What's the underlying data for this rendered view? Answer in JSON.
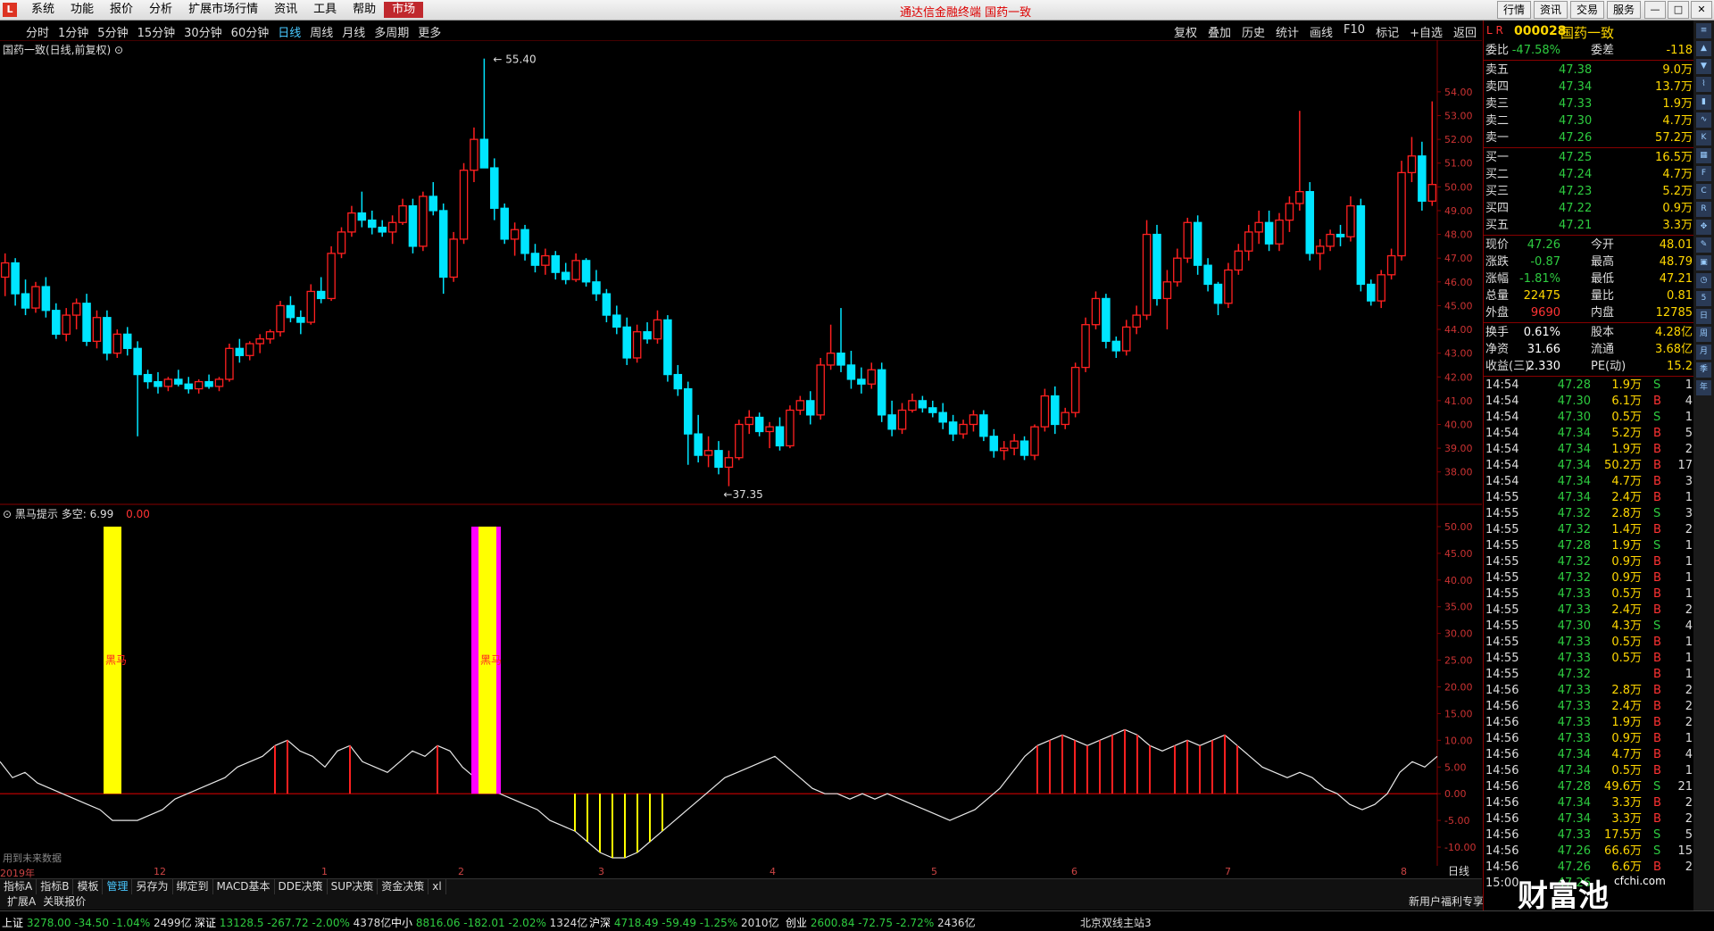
{
  "menu": [
    "系统",
    "功能",
    "报价",
    "分析",
    "扩展市场行情",
    "资讯",
    "工具",
    "帮助",
    "市场"
  ],
  "title_center": "通达信金融终端  国药一致",
  "title_right": [
    "行情",
    "资讯",
    "交易",
    "服务"
  ],
  "periods": [
    "分时",
    "1分钟",
    "5分钟",
    "15分钟",
    "30分钟",
    "60分钟",
    "日线",
    "周线",
    "月线",
    "多周期",
    "更多"
  ],
  "active_period": "日线",
  "tools": [
    "复权",
    "叠加",
    "历史",
    "统计",
    "画线",
    "F10",
    "标记",
    "+自选",
    "返回"
  ],
  "chart_title": "国药一致(日线,前复权)",
  "indicator": {
    "name": "黑马提示",
    "param": "多空: 6.99",
    "value": "0.00",
    "mark": "黑马",
    "future_note": "用到未来数据"
  },
  "colors": {
    "up": "#ff2020",
    "down": "#00e5ff",
    "yellow": "#ffff00",
    "magenta": "#ff00ff",
    "green": "#2ecc40"
  },
  "chart_data": {
    "type": "candlestick",
    "high_label": "55.40",
    "low_label": "37.35",
    "yaxis_main": [
      "54.00",
      "53.00",
      "52.00",
      "51.00",
      "50.00",
      "49.00",
      "48.00",
      "47.00",
      "46.00",
      "45.00",
      "44.00",
      "43.00",
      "42.00",
      "41.00",
      "40.00",
      "39.00",
      "38.00"
    ],
    "yaxis_ind": [
      "50.00",
      "45.00",
      "40.00",
      "35.00",
      "30.00",
      "25.00",
      "20.00",
      "15.00",
      "10.00",
      "5.00",
      "0.00",
      "-5.00",
      "-10.00"
    ],
    "ylim_main": [
      37.2,
      55.8
    ],
    "ylim_ind": [
      -12,
      52
    ],
    "candles": [
      [
        46.2,
        47.2,
        45.4,
        46.8
      ],
      [
        46.8,
        47.0,
        45.0,
        45.5
      ],
      [
        45.5,
        46.1,
        44.6,
        44.9
      ],
      [
        44.9,
        46.0,
        44.7,
        45.8
      ],
      [
        45.8,
        46.2,
        44.5,
        44.8
      ],
      [
        44.8,
        45.1,
        43.6,
        43.8
      ],
      [
        43.8,
        44.9,
        43.5,
        44.6
      ],
      [
        44.6,
        45.3,
        44.0,
        45.1
      ],
      [
        45.1,
        45.5,
        43.3,
        43.5
      ],
      [
        43.5,
        44.8,
        43.2,
        44.5
      ],
      [
        44.5,
        44.8,
        42.7,
        43.0
      ],
      [
        43.0,
        44.0,
        42.8,
        43.8
      ],
      [
        43.8,
        44.1,
        42.9,
        43.2
      ],
      [
        43.2,
        43.5,
        39.5,
        42.1
      ],
      [
        42.1,
        42.3,
        41.5,
        41.8
      ],
      [
        41.8,
        42.2,
        41.3,
        41.6
      ],
      [
        41.6,
        42.0,
        41.4,
        41.9
      ],
      [
        41.9,
        42.3,
        41.6,
        41.7
      ],
      [
        41.7,
        42.0,
        41.3,
        41.5
      ],
      [
        41.5,
        41.9,
        41.3,
        41.8
      ],
      [
        41.8,
        42.1,
        41.5,
        41.6
      ],
      [
        41.6,
        42.0,
        41.4,
        41.9
      ],
      [
        41.9,
        43.4,
        41.8,
        43.2
      ],
      [
        43.2,
        43.6,
        42.6,
        42.9
      ],
      [
        42.9,
        43.5,
        42.7,
        43.4
      ],
      [
        43.4,
        43.8,
        43.0,
        43.6
      ],
      [
        43.6,
        44.0,
        43.4,
        43.9
      ],
      [
        43.9,
        45.2,
        43.7,
        45.0
      ],
      [
        45.0,
        45.4,
        44.3,
        44.5
      ],
      [
        44.5,
        44.8,
        43.8,
        44.3
      ],
      [
        44.3,
        45.9,
        44.2,
        45.6
      ],
      [
        45.6,
        46.2,
        45.1,
        45.3
      ],
      [
        45.3,
        47.5,
        45.2,
        47.2
      ],
      [
        47.2,
        48.3,
        47.0,
        48.1
      ],
      [
        48.1,
        49.2,
        47.9,
        48.9
      ],
      [
        48.9,
        49.8,
        48.3,
        48.6
      ],
      [
        48.6,
        49.0,
        48.0,
        48.3
      ],
      [
        48.3,
        48.6,
        47.9,
        48.1
      ],
      [
        48.1,
        48.8,
        47.6,
        48.5
      ],
      [
        48.5,
        49.5,
        48.4,
        49.2
      ],
      [
        49.2,
        49.5,
        47.2,
        47.5
      ],
      [
        47.5,
        49.8,
        47.3,
        49.6
      ],
      [
        49.6,
        50.2,
        48.8,
        49.0
      ],
      [
        49.0,
        49.3,
        45.5,
        46.2
      ],
      [
        46.2,
        48.1,
        46.0,
        47.8
      ],
      [
        47.8,
        51.0,
        47.6,
        50.7
      ],
      [
        50.7,
        52.5,
        50.2,
        52.0
      ],
      [
        52.0,
        55.4,
        51.8,
        50.8
      ],
      [
        50.8,
        51.2,
        48.6,
        49.1
      ],
      [
        49.1,
        49.3,
        47.6,
        47.8
      ],
      [
        47.8,
        48.5,
        47.1,
        48.2
      ],
      [
        48.2,
        48.4,
        46.9,
        47.2
      ],
      [
        47.2,
        47.6,
        46.4,
        46.7
      ],
      [
        46.7,
        47.4,
        46.3,
        47.1
      ],
      [
        47.1,
        47.3,
        46.1,
        46.4
      ],
      [
        46.4,
        46.8,
        45.9,
        46.1
      ],
      [
        46.1,
        47.2,
        46.0,
        46.9
      ],
      [
        46.9,
        47.0,
        45.8,
        46.0
      ],
      [
        46.0,
        46.5,
        45.2,
        45.5
      ],
      [
        45.5,
        45.7,
        44.3,
        44.6
      ],
      [
        44.6,
        45.0,
        43.8,
        44.1
      ],
      [
        44.1,
        44.5,
        42.5,
        42.8
      ],
      [
        42.8,
        44.2,
        42.6,
        43.9
      ],
      [
        43.9,
        44.3,
        43.4,
        43.6
      ],
      [
        43.6,
        44.8,
        43.4,
        44.4
      ],
      [
        44.4,
        44.6,
        41.8,
        42.1
      ],
      [
        42.1,
        42.5,
        41.2,
        41.5
      ],
      [
        41.5,
        41.8,
        38.3,
        39.6
      ],
      [
        39.6,
        40.4,
        38.4,
        38.7
      ],
      [
        38.7,
        39.5,
        38.2,
        38.9
      ],
      [
        38.9,
        39.3,
        37.9,
        38.2
      ],
      [
        38.2,
        38.9,
        37.4,
        38.6
      ],
      [
        38.6,
        40.2,
        38.5,
        40.0
      ],
      [
        40.0,
        40.6,
        39.6,
        40.3
      ],
      [
        40.3,
        40.5,
        39.5,
        39.7
      ],
      [
        39.7,
        40.1,
        39.0,
        39.9
      ],
      [
        39.9,
        40.3,
        38.9,
        39.1
      ],
      [
        39.1,
        40.8,
        39.0,
        40.6
      ],
      [
        40.6,
        41.2,
        40.4,
        41.0
      ],
      [
        41.0,
        41.4,
        40.0,
        40.4
      ],
      [
        40.4,
        42.8,
        40.2,
        42.5
      ],
      [
        42.5,
        44.2,
        42.3,
        43.0
      ],
      [
        43.0,
        44.9,
        42.2,
        42.5
      ],
      [
        42.5,
        43.1,
        41.5,
        41.9
      ],
      [
        41.9,
        42.4,
        41.3,
        41.7
      ],
      [
        41.7,
        42.6,
        41.5,
        42.3
      ],
      [
        42.3,
        42.6,
        40.1,
        40.4
      ],
      [
        40.4,
        41.0,
        39.5,
        39.8
      ],
      [
        39.8,
        40.9,
        39.6,
        40.6
      ],
      [
        40.6,
        41.3,
        40.5,
        41.0
      ],
      [
        41.0,
        41.2,
        40.5,
        40.7
      ],
      [
        40.7,
        41.0,
        40.3,
        40.5
      ],
      [
        40.5,
        40.9,
        39.8,
        40.1
      ],
      [
        40.1,
        40.4,
        39.3,
        39.6
      ],
      [
        39.6,
        40.2,
        39.4,
        40.0
      ],
      [
        40.0,
        40.6,
        39.7,
        40.4
      ],
      [
        40.4,
        40.6,
        39.3,
        39.5
      ],
      [
        39.5,
        39.8,
        38.6,
        38.9
      ],
      [
        38.9,
        39.3,
        38.5,
        39.0
      ],
      [
        39.0,
        39.6,
        38.7,
        39.3
      ],
      [
        39.3,
        39.5,
        38.5,
        38.7
      ],
      [
        38.7,
        40.0,
        38.5,
        39.9
      ],
      [
        39.9,
        41.5,
        39.7,
        41.2
      ],
      [
        41.2,
        41.6,
        39.6,
        40.0
      ],
      [
        40.0,
        40.7,
        39.8,
        40.5
      ],
      [
        40.5,
        42.6,
        40.3,
        42.4
      ],
      [
        42.4,
        44.5,
        42.2,
        44.2
      ],
      [
        44.2,
        45.6,
        44.0,
        45.3
      ],
      [
        45.3,
        45.5,
        43.2,
        43.5
      ],
      [
        43.5,
        43.7,
        42.8,
        43.1
      ],
      [
        43.1,
        44.4,
        42.9,
        44.1
      ],
      [
        44.1,
        45.0,
        43.8,
        44.6
      ],
      [
        44.6,
        48.6,
        44.4,
        48.0
      ],
      [
        48.0,
        48.4,
        45.0,
        45.3
      ],
      [
        45.3,
        46.5,
        44.0,
        46.0
      ],
      [
        46.0,
        47.4,
        45.8,
        47.0
      ],
      [
        47.0,
        48.7,
        46.8,
        48.5
      ],
      [
        48.5,
        48.8,
        46.3,
        46.7
      ],
      [
        46.7,
        47.0,
        45.6,
        45.9
      ],
      [
        45.9,
        46.0,
        44.6,
        45.1
      ],
      [
        45.1,
        46.8,
        44.9,
        46.5
      ],
      [
        46.5,
        47.6,
        46.3,
        47.3
      ],
      [
        47.3,
        48.4,
        46.9,
        48.1
      ],
      [
        48.1,
        49.0,
        47.6,
        48.5
      ],
      [
        48.5,
        49.0,
        47.3,
        47.6
      ],
      [
        47.6,
        48.9,
        47.3,
        48.6
      ],
      [
        48.6,
        49.6,
        48.1,
        49.3
      ],
      [
        49.3,
        53.2,
        49.0,
        49.8
      ],
      [
        49.8,
        50.2,
        46.9,
        47.2
      ],
      [
        47.2,
        47.8,
        46.5,
        47.5
      ],
      [
        47.5,
        48.2,
        47.3,
        48.0
      ],
      [
        48.0,
        48.4,
        47.5,
        47.9
      ],
      [
        47.9,
        49.6,
        47.7,
        49.2
      ],
      [
        49.2,
        49.5,
        45.6,
        45.9
      ],
      [
        45.9,
        46.1,
        45.0,
        45.2
      ],
      [
        45.2,
        46.5,
        44.9,
        46.3
      ],
      [
        46.3,
        47.4,
        46.1,
        47.1
      ],
      [
        47.1,
        51.1,
        46.9,
        50.6
      ],
      [
        50.6,
        52.1,
        50.2,
        51.3
      ],
      [
        51.3,
        51.9,
        49.0,
        49.4
      ],
      [
        49.4,
        53.6,
        49.2,
        50.1
      ]
    ],
    "osc": [
      6,
      3,
      4,
      2,
      1,
      0,
      -1,
      -2,
      -3,
      -5,
      -5,
      -5,
      -4,
      -3,
      -1,
      0,
      1,
      2,
      3,
      5,
      6,
      7,
      9,
      10,
      8,
      7,
      5,
      8,
      9,
      6,
      5,
      4,
      6,
      8,
      7,
      9,
      8,
      5,
      3,
      1,
      0,
      -1,
      -2,
      -3,
      -5,
      -6,
      -7,
      -9,
      -11,
      -12,
      -12,
      -11,
      -9,
      -7,
      -5,
      -3,
      -1,
      1,
      3,
      4,
      5,
      6,
      7,
      5,
      3,
      1,
      0,
      0,
      -1,
      0,
      -1,
      0,
      -1,
      -2,
      -3,
      -4,
      -5,
      -4,
      -3,
      -1,
      1,
      4,
      7,
      9,
      10,
      11,
      10,
      9,
      10,
      11,
      12,
      11,
      9,
      8,
      9,
      10,
      9,
      10,
      11,
      9,
      7,
      5,
      4,
      3,
      4,
      3,
      1,
      0,
      -2,
      -3,
      -2,
      0,
      4,
      6,
      5,
      7
    ],
    "yellow_bars": [
      {
        "idx": 9,
        "w": 2
      },
      {
        "idx": 39,
        "w": 2
      }
    ],
    "magenta_bars": [
      {
        "idx": 39,
        "w": 3
      }
    ]
  },
  "dates": [
    "2019年",
    "12",
    "1",
    "2",
    "3",
    "4",
    "5",
    "6",
    "7",
    "8"
  ],
  "period_label": "日线",
  "ind_tabs": [
    "指标A",
    "指标B",
    "模板",
    "管理",
    "另存为",
    "绑定到",
    "MACD基本",
    "DDE决策",
    "SUP决策",
    "资金决策",
    "xl"
  ],
  "ind_tabs_active": "管理",
  "sub_left": [
    "扩展A",
    "关联报价"
  ],
  "sub_right": "新用户福利专享",
  "status": [
    {
      "name": "上证",
      "val": "3278.00",
      "chg": "-34.50",
      "pct": "-1.04%",
      "amt": "2499亿"
    },
    {
      "name": "深证",
      "val": "13128.5",
      "chg": "-267.72",
      "pct": "-2.00%",
      "amt": "4378亿"
    },
    {
      "name": "中小",
      "val": "8816.06",
      "chg": "-182.01",
      "pct": "-2.02%",
      "amt": "1324亿"
    },
    {
      "name": "沪深",
      "val": "4718.49",
      "chg": "-59.49",
      "pct": "-1.25%",
      "amt": "2010亿"
    },
    {
      "name": "创业",
      "val": "2600.84",
      "chg": "-72.75",
      "pct": "-2.72%",
      "amt": "2436亿"
    }
  ],
  "status_station": "北京双线主站3",
  "quote": {
    "code": "000028",
    "name": "国药一致",
    "weibi": {
      "label": "委比",
      "val": "-47.58%",
      "label2": "委差",
      "val2": "-118"
    },
    "sell": [
      {
        "l": "卖五",
        "p": "47.38",
        "v": "9.0万"
      },
      {
        "l": "卖四",
        "p": "47.34",
        "v": "13.7万"
      },
      {
        "l": "卖三",
        "p": "47.33",
        "v": "1.9万"
      },
      {
        "l": "卖二",
        "p": "47.30",
        "v": "4.7万"
      },
      {
        "l": "卖一",
        "p": "47.26",
        "v": "57.2万"
      }
    ],
    "buy": [
      {
        "l": "买一",
        "p": "47.25",
        "v": "16.5万"
      },
      {
        "l": "买二",
        "p": "47.24",
        "v": "4.7万"
      },
      {
        "l": "买三",
        "p": "47.23",
        "v": "5.2万"
      },
      {
        "l": "买四",
        "p": "47.22",
        "v": "0.9万"
      },
      {
        "l": "买五",
        "p": "47.21",
        "v": "3.3万"
      }
    ],
    "stats": [
      {
        "l": "现价",
        "v": "47.26",
        "l2": "今开",
        "v2": "48.01",
        "c1": "g",
        "c2": "r"
      },
      {
        "l": "涨跌",
        "v": "-0.87",
        "l2": "最高",
        "v2": "48.79",
        "c1": "g",
        "c2": "r"
      },
      {
        "l": "涨幅",
        "v": "-1.81%",
        "l2": "最低",
        "v2": "47.21",
        "c1": "g",
        "c2": "g"
      },
      {
        "l": "总量",
        "v": "22475",
        "l2": "量比",
        "v2": "0.81",
        "c1": "y",
        "c2": "y"
      },
      {
        "l": "外盘",
        "v": "9690",
        "l2": "内盘",
        "v2": "12785",
        "c1": "r",
        "c2": "g"
      }
    ],
    "stats2": [
      {
        "l": "换手",
        "v": "0.61%",
        "l2": "股本",
        "v2": "4.28亿"
      },
      {
        "l": "净资",
        "v": "31.66",
        "l2": "流通",
        "v2": "3.68亿"
      },
      {
        "l": "收益(三)",
        "v": "2.330",
        "l2": "PE(动)",
        "v2": "15.2"
      }
    ],
    "ticks": [
      [
        "14:54",
        "47.28",
        "1.9万",
        "S",
        "1"
      ],
      [
        "14:54",
        "47.30",
        "6.1万",
        "B",
        "4"
      ],
      [
        "14:54",
        "47.30",
        "0.5万",
        "S",
        "1"
      ],
      [
        "14:54",
        "47.34",
        "5.2万",
        "B",
        "5"
      ],
      [
        "14:54",
        "47.34",
        "1.9万",
        "B",
        "2"
      ],
      [
        "14:54",
        "47.34",
        "50.2万",
        "B",
        "17"
      ],
      [
        "14:54",
        "47.34",
        "4.7万",
        "B",
        "3"
      ],
      [
        "14:55",
        "47.34",
        "2.4万",
        "B",
        "1"
      ],
      [
        "14:55",
        "47.32",
        "2.8万",
        "S",
        "3"
      ],
      [
        "14:55",
        "47.32",
        "1.4万",
        "B",
        "2"
      ],
      [
        "14:55",
        "47.28",
        "1.9万",
        "S",
        "1"
      ],
      [
        "14:55",
        "47.32",
        "0.9万",
        "B",
        "1"
      ],
      [
        "14:55",
        "47.32",
        "0.9万",
        "B",
        "1"
      ],
      [
        "14:55",
        "47.33",
        "0.5万",
        "B",
        "1"
      ],
      [
        "14:55",
        "47.33",
        "2.4万",
        "B",
        "2"
      ],
      [
        "14:55",
        "47.30",
        "4.3万",
        "S",
        "4"
      ],
      [
        "14:55",
        "47.33",
        "0.5万",
        "B",
        "1"
      ],
      [
        "14:55",
        "47.33",
        "0.5万",
        "B",
        "1"
      ],
      [
        "14:55",
        "47.32",
        "",
        "B",
        "1"
      ],
      [
        "14:56",
        "47.33",
        "2.8万",
        "B",
        "2"
      ],
      [
        "14:56",
        "47.33",
        "2.4万",
        "B",
        "2"
      ],
      [
        "14:56",
        "47.33",
        "1.9万",
        "B",
        "2"
      ],
      [
        "14:56",
        "47.33",
        "0.9万",
        "B",
        "1"
      ],
      [
        "14:56",
        "47.34",
        "4.7万",
        "B",
        "4"
      ],
      [
        "14:56",
        "47.34",
        "0.5万",
        "B",
        "1"
      ],
      [
        "14:56",
        "47.28",
        "49.6万",
        "S",
        "21"
      ],
      [
        "14:56",
        "47.34",
        "3.3万",
        "B",
        "2"
      ],
      [
        "14:56",
        "47.34",
        "3.3万",
        "B",
        "2"
      ],
      [
        "14:56",
        "47.33",
        "17.5万",
        "S",
        "5"
      ],
      [
        "14:56",
        "47.26",
        "66.6万",
        "S",
        "15"
      ],
      [
        "14:56",
        "47.26",
        "6.6万",
        "B",
        "2"
      ],
      [
        "15:00",
        "47.26",
        "",
        "",
        ""
      ]
    ]
  },
  "brand": "财富池",
  "brand_url": "cfchi.com"
}
